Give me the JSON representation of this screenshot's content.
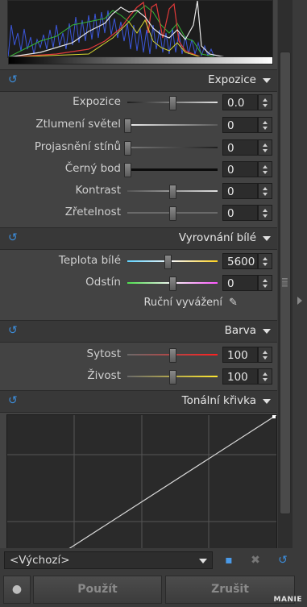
{
  "sections": {
    "exposure": {
      "title": "Expozice",
      "rows": [
        {
          "label": "Expozice",
          "value": "0.0",
          "slider_pos": 0.5
        },
        {
          "label": "Ztlumení světel",
          "value": "0",
          "slider_pos": 0.0
        },
        {
          "label": "Projasnění stínů",
          "value": "0",
          "slider_pos": 0.0
        },
        {
          "label": "Černý bod",
          "value": "0",
          "slider_pos": 0.0
        },
        {
          "label": "Kontrast",
          "value": "0",
          "slider_pos": 0.5
        },
        {
          "label": "Zřetelnost",
          "value": "0",
          "slider_pos": 0.5
        }
      ]
    },
    "white_balance": {
      "title": "Vyrovnání bílé",
      "rows": [
        {
          "label": "Teplota bílé",
          "value": "5600",
          "slider_pos": 0.45
        },
        {
          "label": "Odstín",
          "value": "0",
          "slider_pos": 0.5
        }
      ],
      "manual_label": "Ruční vyvážení"
    },
    "color": {
      "title": "Barva",
      "rows": [
        {
          "label": "Sytost",
          "value": "100",
          "slider_pos": 0.5
        },
        {
          "label": "Živost",
          "value": "100",
          "slider_pos": 0.5
        }
      ]
    },
    "curve": {
      "title": "Tonální křivka"
    }
  },
  "preset": {
    "selected": "<Výchozí>"
  },
  "buttons": {
    "apply": "Použít",
    "cancel": "Zrušit"
  },
  "watermark": "MANIE",
  "colors": {
    "accent_blue": "#3c8ddb",
    "panel_bg": "#434343"
  },
  "icons": {
    "reset": "reset-icon",
    "dropdown": "chevron-down-icon",
    "spin": "spinner-arrows-icon",
    "picker": "eyedropper-icon",
    "save": "save-icon",
    "delete": "delete-preset-icon",
    "undo": "undo-icon",
    "person": "person-icon"
  }
}
